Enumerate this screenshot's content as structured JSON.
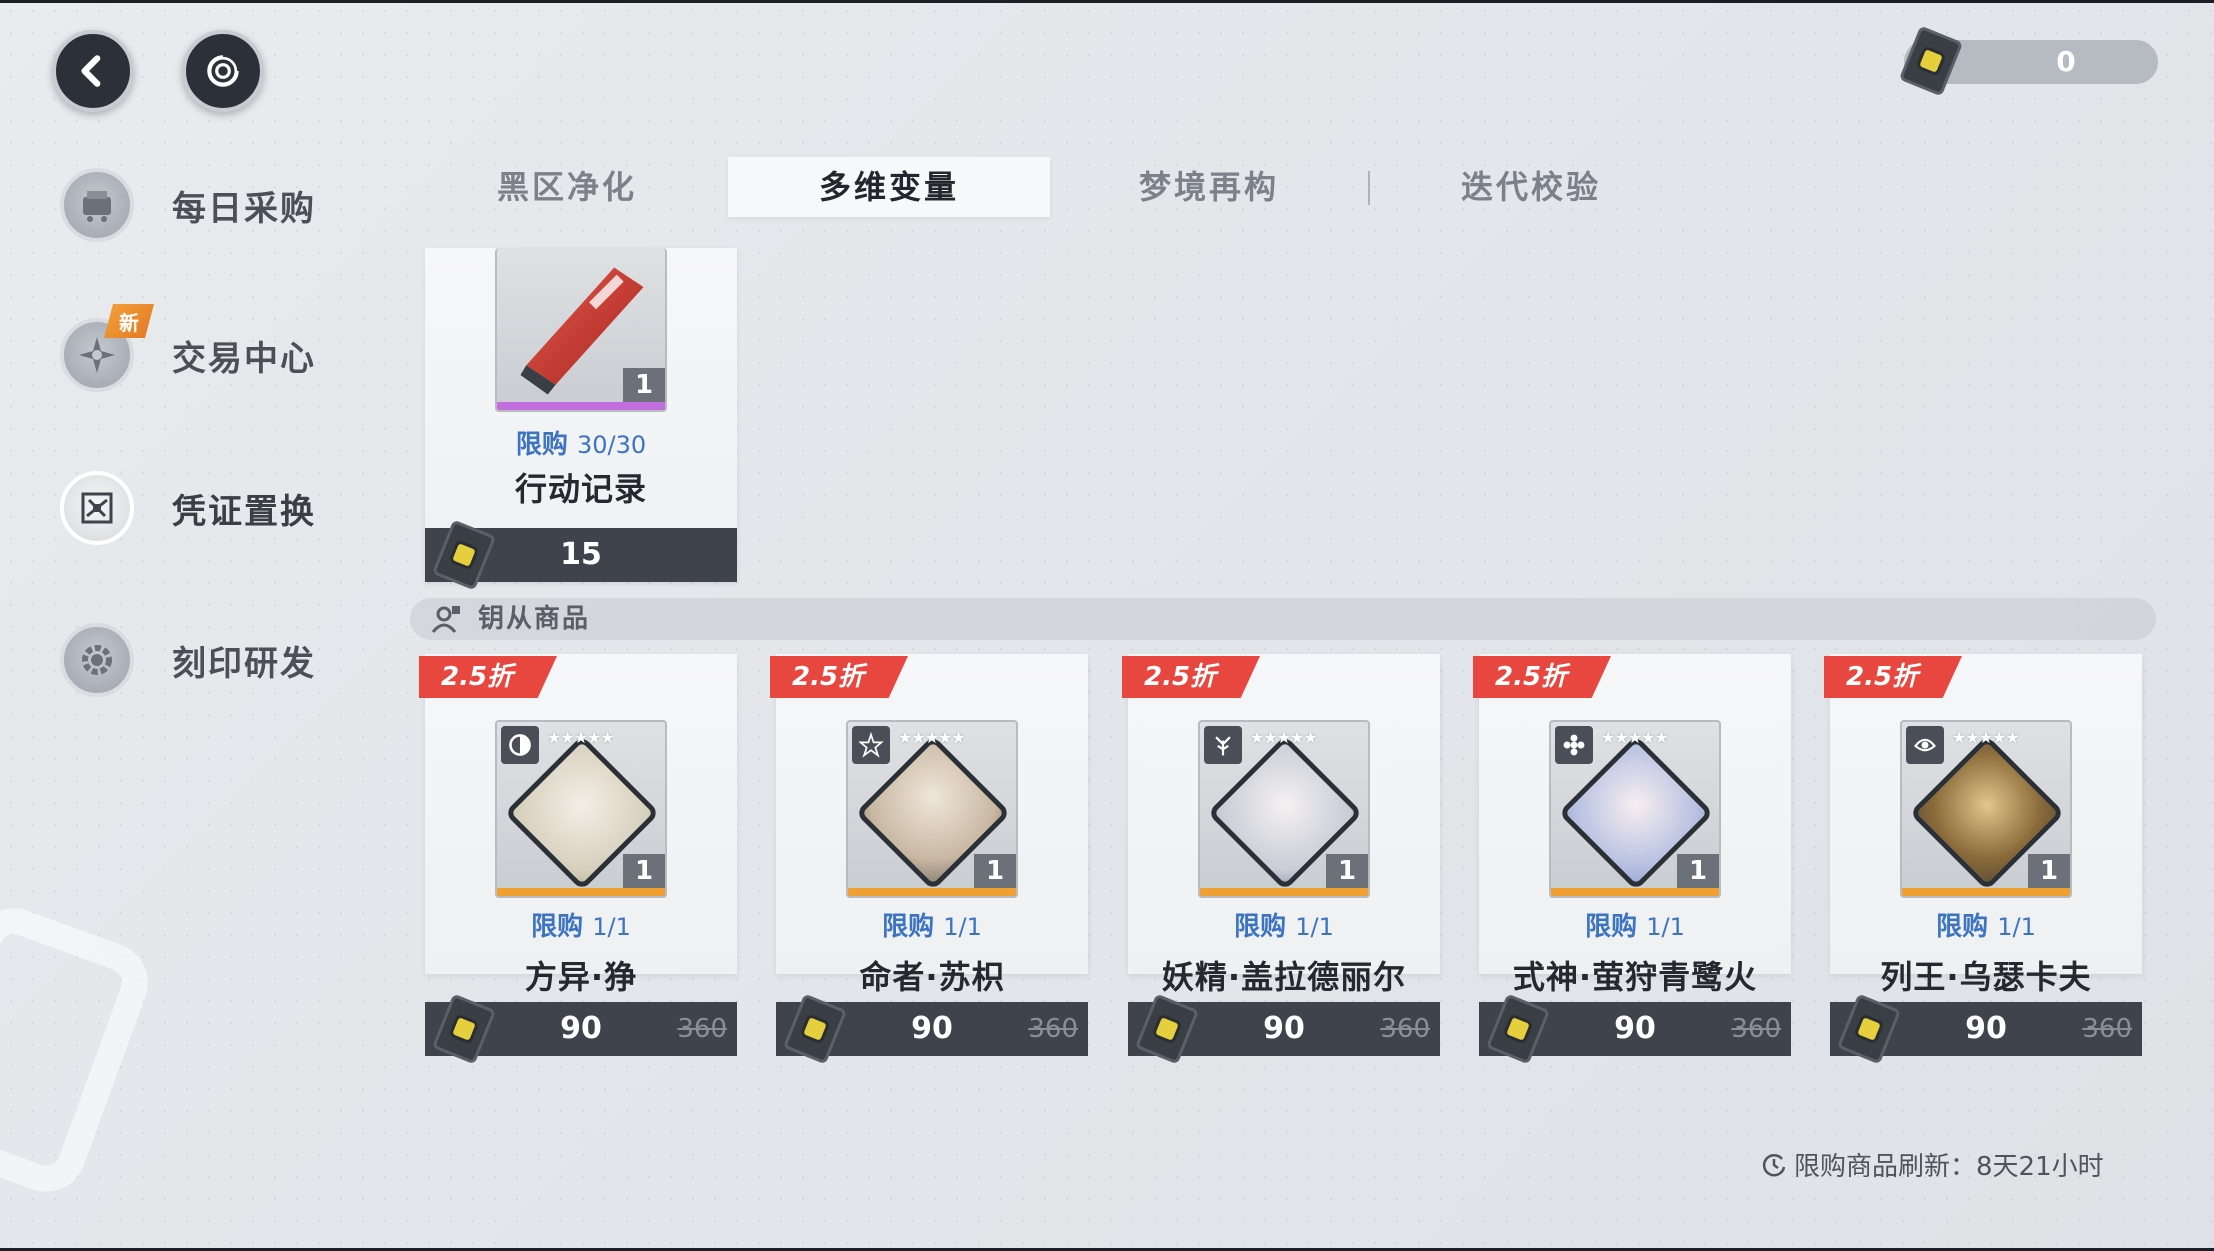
{
  "currency": {
    "amount": "0"
  },
  "sidebar": {
    "items": [
      {
        "label": "每日采购",
        "icon": "cart-icon"
      },
      {
        "label": "交易中心",
        "icon": "compass-star-icon",
        "badge": "新"
      },
      {
        "label": "凭证置换",
        "icon": "exchange-icon"
      },
      {
        "label": "刻印研发",
        "icon": "gear-icon"
      }
    ]
  },
  "tabs": [
    {
      "label": "黑区净化"
    },
    {
      "label": "多维变量"
    },
    {
      "label": "梦境再构"
    },
    {
      "label": "迭代校验"
    }
  ],
  "top_item": {
    "limit_label": "限购",
    "limit_value": "30/30",
    "name": "行动记录",
    "quantity": "1",
    "price": "15"
  },
  "section": {
    "label": "钥从商品"
  },
  "products": [
    {
      "discount": "2.5折",
      "limit_label": "限购",
      "limit_value": "1/1",
      "name": "方异·狰",
      "quantity": "1",
      "price": "90",
      "original_price": "360",
      "stars": "★★★★★"
    },
    {
      "discount": "2.5折",
      "limit_label": "限购",
      "limit_value": "1/1",
      "name": "命者·苏枳",
      "quantity": "1",
      "price": "90",
      "original_price": "360",
      "stars": "★★★★★"
    },
    {
      "discount": "2.5折",
      "limit_label": "限购",
      "limit_value": "1/1",
      "name": "妖精·盖拉德丽尔",
      "quantity": "1",
      "price": "90",
      "original_price": "360",
      "stars": "★★★★★"
    },
    {
      "discount": "2.5折",
      "limit_label": "限购",
      "limit_value": "1/1",
      "name": "式神·萤狩青鹭火",
      "quantity": "1",
      "price": "90",
      "original_price": "360",
      "stars": "★★★★★"
    },
    {
      "discount": "2.5折",
      "limit_label": "限购",
      "limit_value": "1/1",
      "name": "列王·乌瑟卡夫",
      "quantity": "1",
      "price": "90",
      "original_price": "360",
      "stars": "★★★★★"
    }
  ],
  "refresh": {
    "text": "限购商品刷新：8天21小时"
  },
  "colors": {
    "limit_blue": "#3c74c2",
    "discount_red": "#e8473f",
    "price_bar": "#3f434b",
    "rarity_orange": "#f0a030",
    "rarity_purple": "#c36ee0"
  }
}
